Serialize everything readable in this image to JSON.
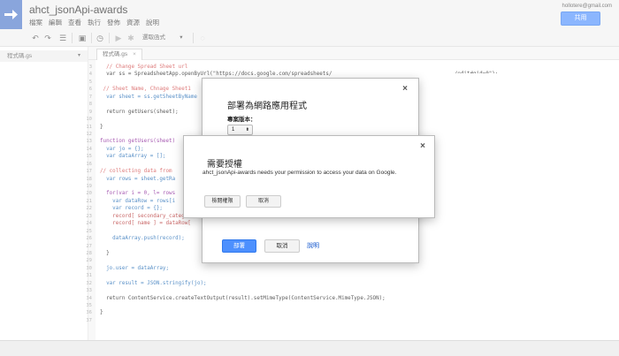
{
  "app": {
    "title": "ahct_jsonApi-awards",
    "user_email": "hollotere@gmail.com",
    "share_label": "共用",
    "menu": [
      "檔案",
      "編輯",
      "查看",
      "執行",
      "發佈",
      "資源",
      "說明"
    ]
  },
  "toolbar": {
    "function_select": "選取函式",
    "function_caret": "▾"
  },
  "sidebar": {
    "file_name": "程式碼.gs",
    "file_caret": "▾"
  },
  "editor": {
    "tab_label": "程式碼.gs",
    "tab_close": "×"
  },
  "code": {
    "line_numbers": [
      "3",
      "4",
      "5",
      "6",
      "7",
      "8",
      "9",
      "10",
      "11",
      "12",
      "13",
      "14",
      "15",
      "16",
      "17",
      "18",
      "19",
      "20",
      "21",
      "22",
      "23",
      "24",
      "25",
      "26",
      "27",
      "28",
      "29",
      "30",
      "31",
      "32",
      "33",
      "34",
      "35",
      "36",
      "37"
    ],
    "lines": [
      {
        "cls": "c-com",
        "text": "  // Change Spread Sheet url"
      },
      {
        "cls": "c-fn",
        "text": "  var ss = SpreadsheetApp.openByUrl(\"https://docs.google.com/spreadsheets/                                       /edit#gid=0\");"
      },
      {
        "cls": "c-fn",
        "text": ""
      },
      {
        "cls": "c-com",
        "text": " // Sheet Name, Chnage Sheet1"
      },
      {
        "cls": "c-var",
        "text": "  var sheet = ss.getSheetByName"
      },
      {
        "cls": "c-fn",
        "text": ""
      },
      {
        "cls": "c-fn",
        "text": "  return getUsers(sheet);"
      },
      {
        "cls": "c-fn",
        "text": ""
      },
      {
        "cls": "c-fn",
        "text": "}"
      },
      {
        "cls": "c-fn",
        "text": ""
      },
      {
        "cls": "c-kw",
        "text": "function getUsers(sheet)"
      },
      {
        "cls": "c-var",
        "text": "  var jo = {};"
      },
      {
        "cls": "c-var",
        "text": "  var dataArray = [];"
      },
      {
        "cls": "c-fn",
        "text": ""
      },
      {
        "cls": "c-com",
        "text": "// collecting data from"
      },
      {
        "cls": "c-var",
        "text": "  var rows = sheet.getRa"
      },
      {
        "cls": "c-fn",
        "text": ""
      },
      {
        "cls": "c-kw",
        "text": "  for(var i = 0, l= rows"
      },
      {
        "cls": "c-var",
        "text": "    var dataRow = rows[i"
      },
      {
        "cls": "c-var",
        "text": "    var record = {};"
      },
      {
        "cls": "c-str",
        "text": "    record[ secondary_categor"
      },
      {
        "cls": "c-str",
        "text": "    record[ name ] = dataRow["
      },
      {
        "cls": "c-fn",
        "text": ""
      },
      {
        "cls": "c-var",
        "text": "    dataArray.push(record);"
      },
      {
        "cls": "c-fn",
        "text": ""
      },
      {
        "cls": "c-fn",
        "text": "  }"
      },
      {
        "cls": "c-fn",
        "text": ""
      },
      {
        "cls": "c-var",
        "text": "  jo.user = dataArray;"
      },
      {
        "cls": "c-fn",
        "text": ""
      },
      {
        "cls": "c-var",
        "text": "  var result = JSON.stringify(jo);"
      },
      {
        "cls": "c-fn",
        "text": ""
      },
      {
        "cls": "c-fn",
        "text": "  return ContentService.createTextOutput(result).setMimeType(ContentService.MimeType.JSON);"
      },
      {
        "cls": "c-fn",
        "text": ""
      },
      {
        "cls": "c-fn",
        "text": "}"
      },
      {
        "cls": "c-fn",
        "text": ""
      }
    ]
  },
  "deploy_dialog": {
    "title": "部署為網路應用程式",
    "close": "×",
    "version_label": "專案版本：",
    "version_value": "1",
    "version_caret": "⬍",
    "deploy_label": "部署",
    "cancel_label": "取消",
    "help_label": "說明"
  },
  "auth_dialog": {
    "title": "需要授權",
    "close": "×",
    "message": "ahct_jsonApi-awards needs your permission to access your data on Google.",
    "review_label": "檢閱權限",
    "cancel_label": "取消"
  },
  "colors": {
    "brand": "#4a76c9",
    "primary_button": "#4d90fe",
    "link": "#1155cc"
  }
}
